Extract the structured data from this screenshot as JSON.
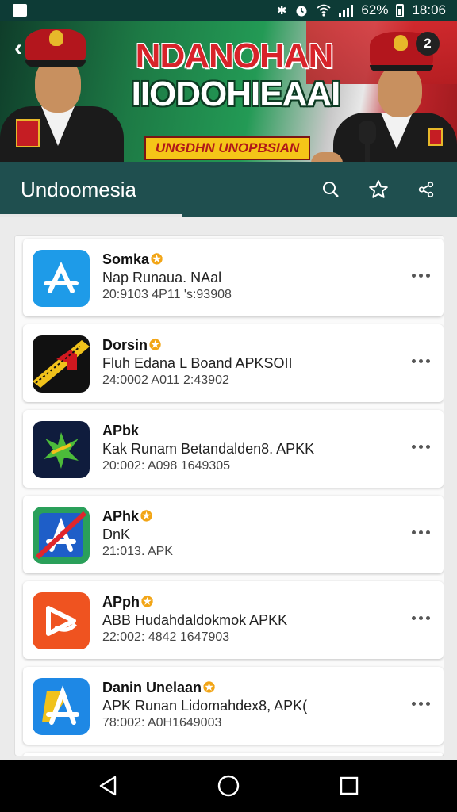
{
  "status_bar": {
    "battery": "62%",
    "time": "18:06",
    "icons": [
      "notification-icon",
      "bluetooth-icon",
      "alarm-icon",
      "wifi-icon",
      "signal-icon",
      "battery-icon"
    ]
  },
  "banner": {
    "title_line1": "NDANOHAN",
    "title_line2": "IIODOHIEAAI",
    "subtitle": "UNGDHN UNOPBSIAN",
    "badge": "2"
  },
  "toolbar": {
    "title": "Undoomesia",
    "icons": [
      "search-icon",
      "star-icon",
      "share-icon"
    ]
  },
  "apps": [
    {
      "name": "Somka",
      "verified": true,
      "description": "Nap Runaua. NAal",
      "meta": "20:9103 4P11 's:93908",
      "icon_color": "#1e9be8"
    },
    {
      "name": "Dorsin",
      "verified": true,
      "description": "Fluh Edana L Boand APKSOII",
      "meta": "24:0002 A011 2:43902",
      "icon_color": "#111111"
    },
    {
      "name": "APbk",
      "verified": false,
      "description": "Kak Runam Betandalden8. APKK",
      "meta": "20:002: A098 1649305",
      "icon_color": "#0f1c3d"
    },
    {
      "name": "APhk",
      "verified": true,
      "description": "DnK",
      "meta": "21:013. APK",
      "icon_color": "#2aa05a"
    },
    {
      "name": "APph",
      "verified": true,
      "description": "ABB Hudahdaldokmok APKK",
      "meta": "22:002: 4842 1647903",
      "icon_color": "#ef5320"
    },
    {
      "name": "Danin Unelaan",
      "verified": true,
      "description": "APK Runan Lidomahdex8, APK(",
      "meta": "78:002: A0H1649003",
      "icon_color": "#1e88e5"
    }
  ],
  "navbar": {
    "icons": [
      "back-icon",
      "home-icon",
      "recents-icon"
    ]
  }
}
